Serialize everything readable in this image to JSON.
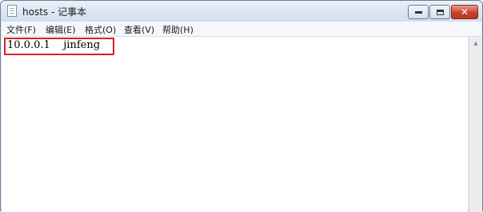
{
  "window": {
    "title": "hosts - 记事本"
  },
  "menu": {
    "items": [
      {
        "label": "文件(F)"
      },
      {
        "label": "编辑(E)"
      },
      {
        "label": "格式(O)"
      },
      {
        "label": "查看(V)"
      },
      {
        "label": "帮助(H)"
      }
    ]
  },
  "editor": {
    "content": "10.0.0.1    jinfeng"
  },
  "icons": {
    "app": "notepad-icon",
    "minimize": "minimize-icon",
    "maximize": "maximize-icon",
    "close": "close-icon",
    "scroll_up": "arrow-up-icon"
  },
  "colors": {
    "highlight_border": "#d4202a",
    "close_button": "#c6422a"
  }
}
